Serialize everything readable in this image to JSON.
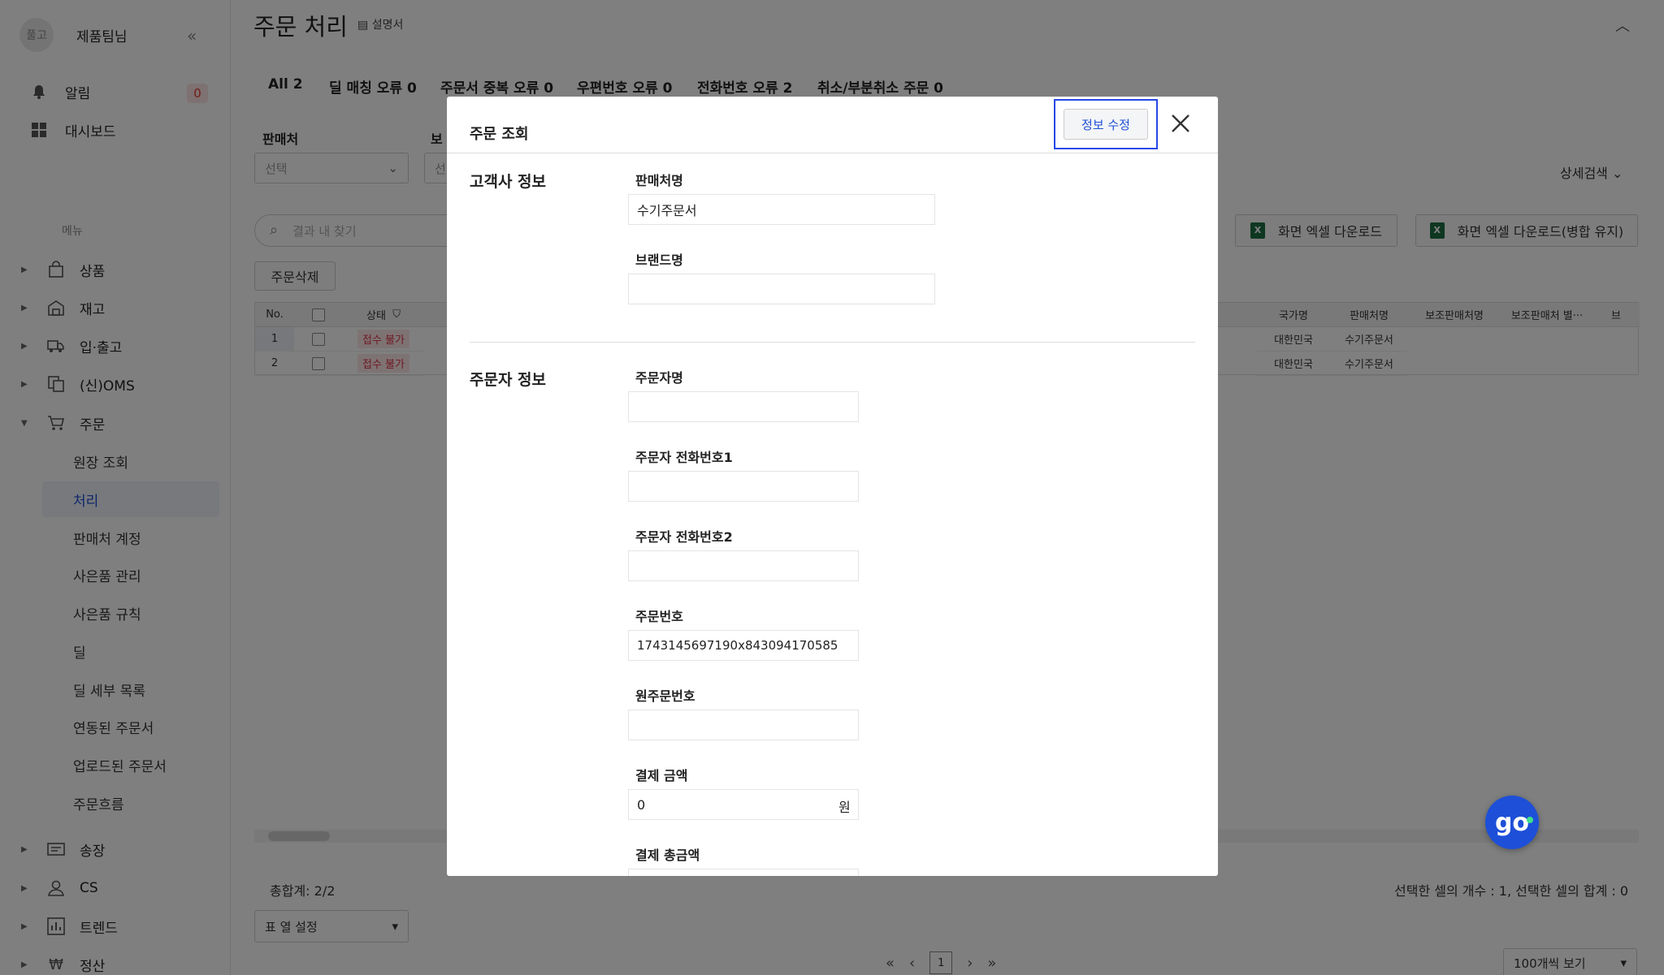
{
  "sidebar": {
    "avatar": "풀고",
    "team": "제품팀님",
    "collapse_icon": "«",
    "alert_label": "알림",
    "alert_count": "0",
    "dashboard_label": "대시보드",
    "menu_caption": "메뉴",
    "menu": [
      {
        "label": "상품",
        "icon": "bag-icon"
      },
      {
        "label": "재고",
        "icon": "warehouse-icon"
      },
      {
        "label": "입·출고",
        "icon": "truck-icon"
      },
      {
        "label": "(신)OMS",
        "icon": "oms-icon"
      },
      {
        "label": "주문",
        "icon": "cart-icon"
      }
    ],
    "order_sub": [
      "원장 조회",
      "처리",
      "판매처 계정",
      "사은품 관리",
      "사은품 규칙",
      "딜",
      "딜 세부 목록",
      "연동된 주문서",
      "업로드된 주문서",
      "주문흐름"
    ],
    "menu_bottom": [
      {
        "label": "송장",
        "icon": "invoice-icon"
      },
      {
        "label": "CS",
        "icon": "person-icon"
      },
      {
        "label": "트렌드",
        "icon": "chart-icon"
      },
      {
        "label": "정산",
        "icon": "won-icon"
      }
    ]
  },
  "page": {
    "title": "주문 처리",
    "manual": "설명서",
    "tabs": [
      "All 2",
      "딜 매칭 오류 0",
      "주문서 중복 오류 0",
      "우편번호 오류 0",
      "전화번호 오류 2",
      "취소/부분취소 주문 0"
    ],
    "filter_seller_label": "판매처",
    "filter_seller_value": "선택",
    "filter_sub_label": "보",
    "filter_sub_value": "선",
    "advanced_search": "상세검색",
    "search_placeholder": "결과 내 찾기",
    "excel_download": "화면 엑셀 다운로드",
    "excel_download_merge": "화면 엑셀 다운로드(병합 유지)",
    "delete_orders": "주문삭제",
    "grid_headers_left": [
      "No.",
      "상태"
    ],
    "grid_headers_right": [
      "국가명",
      "판매처명",
      "보조판매처명",
      "보조판매처 별···",
      "브"
    ],
    "rows": [
      {
        "no": "1",
        "status": "접수 불가",
        "country": "대한민국",
        "seller": "수기주문서"
      },
      {
        "no": "2",
        "status": "접수 불가",
        "country": "대한민국",
        "seller": "수기주문서"
      }
    ],
    "total": "총합계: 2/2",
    "selection_info": "선택한 셀의 개수 : 1, 선택한 셀의 합계 : 0",
    "column_setting": "표 열 설정",
    "current_page": "1",
    "page_size": "100개씩 보기"
  },
  "modal": {
    "title": "주문 조회",
    "edit_button": "정보 수정",
    "customer_section": "고객사 정보",
    "seller_name_label": "판매처명",
    "seller_name_value": "수기주문서",
    "brand_label": "브랜드명",
    "brand_value": "",
    "orderer_section": "주문자 정보",
    "orderer_name_label": "주문자명",
    "orderer_name_value": "",
    "phone1_label": "주문자 전화번호1",
    "phone1_value": "",
    "phone2_label": "주문자 전화번호2",
    "phone2_value": "",
    "order_no_label": "주문번호",
    "order_no_value": "1743145697190x843094170585",
    "orig_order_label": "원주문번호",
    "orig_order_value": "",
    "payment_label": "결제 금액",
    "payment_value": "0",
    "currency_unit": "원",
    "payment_total_label": "결제 총금액"
  },
  "widget": {
    "label": "go"
  },
  "colors": {
    "accent": "#1e4fd6",
    "alert": "#e53935",
    "widget": "#1d4fd8"
  }
}
